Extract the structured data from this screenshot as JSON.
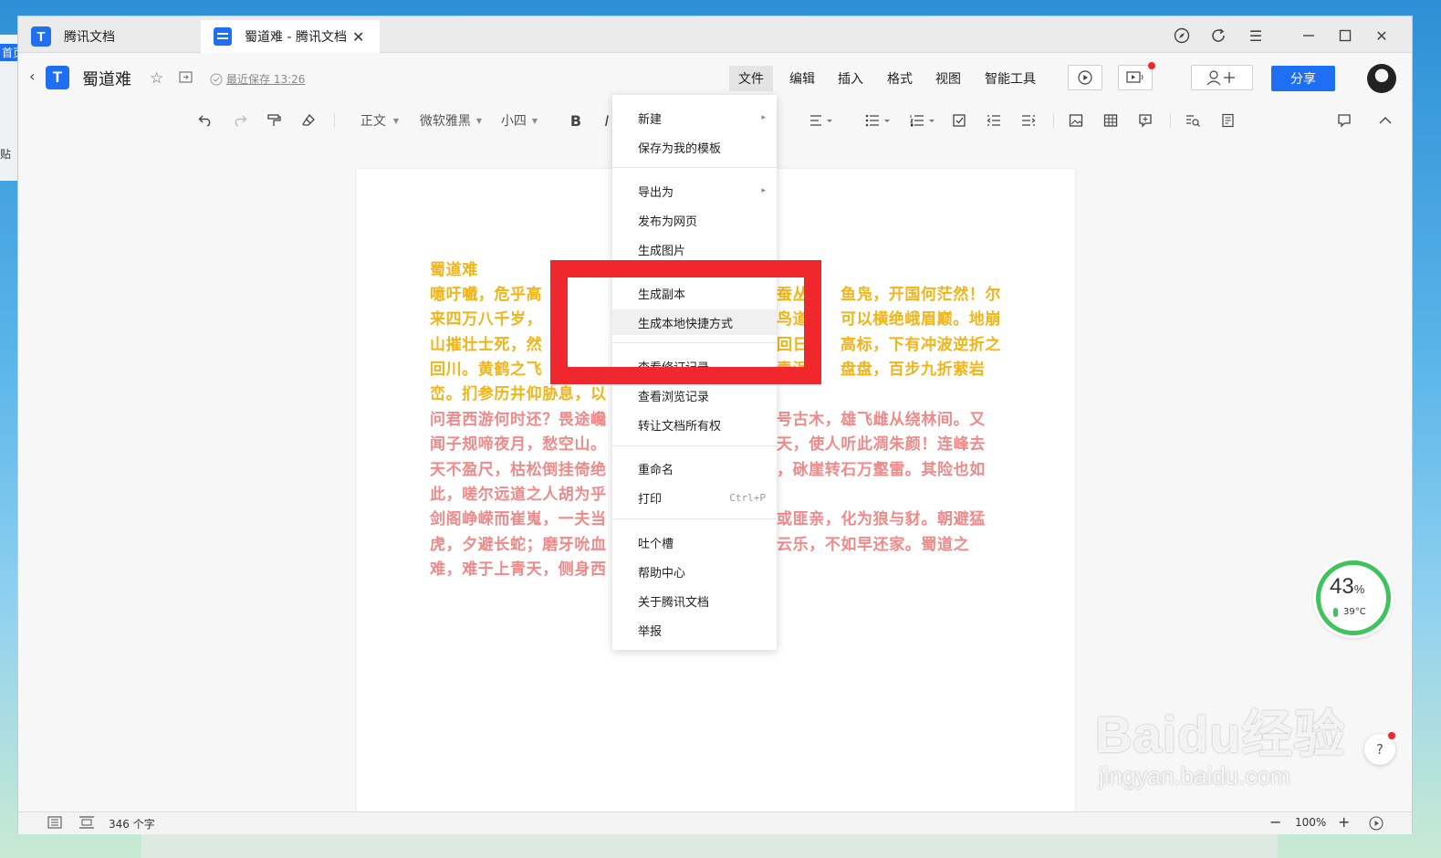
{
  "app": {
    "home_tab": "腾讯文档",
    "doc_tab": "蜀道难 - 腾讯文档",
    "logo_glyph": "T"
  },
  "desktop_peek": {
    "home": "首页",
    "paste": "贴"
  },
  "header": {
    "doc_title": "蜀道难",
    "save_status": "最近保存 13:26",
    "menus": [
      "文件",
      "编辑",
      "插入",
      "格式",
      "视图",
      "智能工具"
    ],
    "share": "分享"
  },
  "toolbar": {
    "style": "正文",
    "font": "微软雅黑",
    "size": "小四",
    "bold": "B",
    "italic": "I"
  },
  "document": {
    "title": "蜀道难",
    "lines_yellow": [
      "噫吁嚱，危乎高",
      "来四万八千岁，",
      "山摧壮士死，然",
      "回川。黄鹤之飞",
      "峦。扪参历井仰胁息，以"
    ],
    "lines_yellow_right": [
      "蚕丛",
      "鸟道",
      "回日",
      "青泥",
      ""
    ],
    "lines_yellow_far": [
      "鱼凫，开国何茫然！尔",
      "可以横绝峨眉巅。地崩",
      "高标，下有冲波逆折之",
      "盘盘，百步九折萦岩",
      ""
    ],
    "lines_pink": [
      "问君西游何时还？畏途巉",
      "闻子规啼夜月，愁空山。",
      "天不盈尺，枯松倒挂倚绝",
      "此，嗟尔远道之人胡为乎",
      "剑阁峥嵘而崔嵬，一夫当",
      "虎，夕避长蛇；磨牙吮血",
      "难，难于上青天，侧身西"
    ],
    "lines_pink_right": [
      "号古木，雄飞雌从绕林间。又",
      "天，使人听此凋朱颜！连峰去",
      "，砯崖转石万壑雷。其险也如",
      "",
      "或匪亲，化为狼与豺。朝避猛",
      "云乐，不如早还家。蜀道之",
      ""
    ]
  },
  "file_menu": {
    "items": [
      "新建",
      "保存为我的模板",
      "导出为",
      "发布为网页",
      "生成图片",
      "生成副本",
      "生成本地快捷方式",
      "查看修订记录",
      "查看浏览记录",
      "转让文档所有权",
      "重命名",
      "打印",
      "吐个槽",
      "帮助中心",
      "关于腾讯文档",
      "举报"
    ],
    "print_shortcut": "Ctrl+P"
  },
  "statusbar": {
    "word_count": "346 个字",
    "zoom": "100%"
  },
  "monitor": {
    "percent": "43",
    "percent_sign": "%",
    "temp": "39°C"
  },
  "help": "?",
  "watermark": {
    "brand": "Baidu经验",
    "url": "jingyan.baidu.com"
  },
  "colors": {
    "accent": "#1e6ff1",
    "poem_yellow": "#f2b416",
    "poem_pink": "#f08a8a",
    "highlight": "#f0282d",
    "monitor_ring": "#3fc35c"
  }
}
